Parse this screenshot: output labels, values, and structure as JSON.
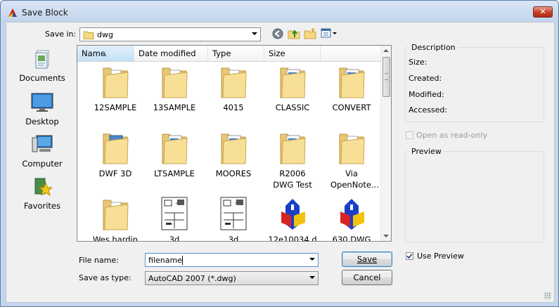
{
  "window": {
    "title": "Save Block",
    "close_symbol": "✕"
  },
  "save_in": {
    "label": "Save in:",
    "value": "dwg"
  },
  "toolbar": {
    "icons": [
      "back-icon",
      "up-folder-icon",
      "new-folder-icon",
      "views-icon"
    ]
  },
  "places": [
    {
      "label": "Documents",
      "icon": "documents-icon"
    },
    {
      "label": "Desktop",
      "icon": "desktop-icon"
    },
    {
      "label": "Computer",
      "icon": "computer-icon"
    },
    {
      "label": "Favorites",
      "icon": "favorites-icon"
    }
  ],
  "columns": [
    "Name",
    "Date modified",
    "Type",
    "Size"
  ],
  "files": [
    {
      "name": "12SAMPLE",
      "kind": "folder-blank"
    },
    {
      "name": "13SAMPLE",
      "kind": "folder-blank"
    },
    {
      "name": "4015",
      "kind": "folder-blank"
    },
    {
      "name": "CLASSIC",
      "kind": "folder-docs"
    },
    {
      "name": "CONVERT",
      "kind": "folder-docs"
    },
    {
      "name": "DWF 3D",
      "kind": "folder-blue"
    },
    {
      "name": "LTSAMPLE",
      "kind": "folder-docs"
    },
    {
      "name": "MOORES",
      "kind": "folder-docs"
    },
    {
      "name": "R2006 DWG Test",
      "kind": "folder-docs"
    },
    {
      "name": "Via OpenNote...",
      "kind": "folder-blank"
    },
    {
      "name": "Wes hardin",
      "kind": "folder-blank"
    },
    {
      "name": "3d",
      "kind": "drawing"
    },
    {
      "name": "3d",
      "kind": "drawing"
    },
    {
      "name": "12e10034.d",
      "kind": "dwg"
    },
    {
      "name": "630 DWG",
      "kind": "dwg"
    }
  ],
  "file_name": {
    "label": "File name:",
    "value": "filename"
  },
  "save_as_type": {
    "label": "Save as type:",
    "value": "AutoCAD 2007 (*.dwg)"
  },
  "buttons": {
    "save": "Save",
    "cancel": "Cancel"
  },
  "description": {
    "title": "Description",
    "size": "Size:",
    "created": "Created:",
    "modified": "Modified:",
    "accessed": "Accessed:"
  },
  "open_read_only": {
    "label": "Open as read-only",
    "checked": false,
    "enabled": false
  },
  "preview": {
    "title": "Preview"
  },
  "use_preview": {
    "label": "Use Preview",
    "checked": true
  }
}
